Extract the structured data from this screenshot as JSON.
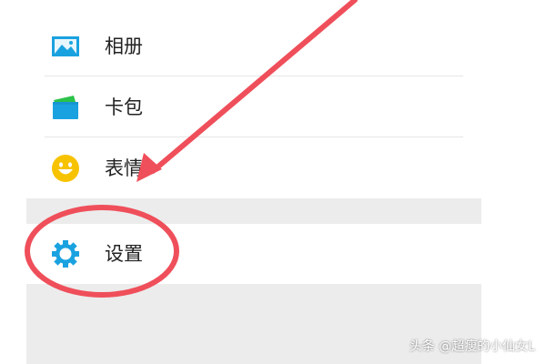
{
  "menu": {
    "items": [
      {
        "label": "相册",
        "icon": "album-icon"
      },
      {
        "label": "卡包",
        "icon": "card-wallet-icon"
      },
      {
        "label": "表情",
        "icon": "emoji-icon"
      },
      {
        "label": "设置",
        "icon": "settings-gear-icon"
      }
    ]
  },
  "watermark": "头条 @超瘦的小仙女L",
  "colors": {
    "accent_blue": "#1aa2e0",
    "card_green": "#2bc24a",
    "emoji_yellow": "#f7c300",
    "annotation_red": "#ef4f5a",
    "band_gray": "#ececec"
  }
}
